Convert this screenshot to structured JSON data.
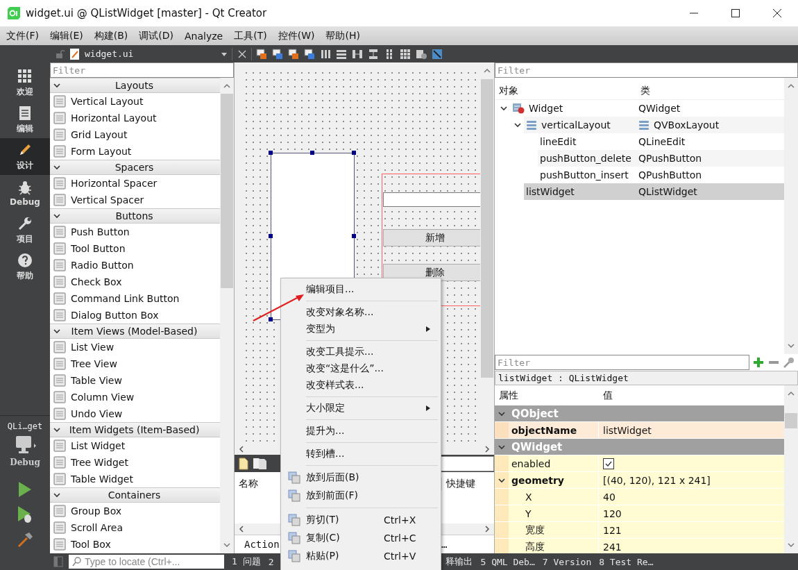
{
  "window": {
    "title": "widget.ui @ QListWidget [master] - Qt Creator"
  },
  "menu_bar": [
    "文件(F)",
    "编辑(E)",
    "构建(B)",
    "调试(D)",
    "Analyze",
    "工具(T)",
    "控件(W)",
    "帮助(H)"
  ],
  "mode_bar": {
    "modes": [
      {
        "label": "欢迎",
        "selected": false
      },
      {
        "label": "编辑",
        "selected": false
      },
      {
        "label": "设计",
        "selected": true
      },
      {
        "label": "Debug",
        "selected": false
      },
      {
        "label": "项目",
        "selected": false
      },
      {
        "label": "帮助",
        "selected": false
      }
    ],
    "kit": "QLi…get",
    "build_config": "Debug"
  },
  "editor_toolbar": {
    "file": "widget.ui"
  },
  "widget_box": {
    "filter": {
      "placeholder": "Filter"
    },
    "categories": [
      {
        "title": "Layouts",
        "expanded": true,
        "items": [
          "Vertical Layout",
          "Horizontal Layout",
          "Grid Layout",
          "Form Layout"
        ]
      },
      {
        "title": "Spacers",
        "expanded": true,
        "items": [
          "Horizontal Spacer",
          "Vertical Spacer"
        ]
      },
      {
        "title": "Buttons",
        "expanded": true,
        "items": [
          "Push Button",
          "Tool Button",
          "Radio Button",
          "Check Box",
          "Command Link Button",
          "Dialog Button Box"
        ]
      },
      {
        "title": "Item Views (Model-Based)",
        "expanded": true,
        "items": [
          "List View",
          "Tree View",
          "Table View",
          "Column View",
          "Undo View"
        ]
      },
      {
        "title": "Item Widgets (Item-Based)",
        "expanded": true,
        "items": [
          "List Widget",
          "Tree Widget",
          "Table Widget"
        ]
      },
      {
        "title": "Containers",
        "expanded": true,
        "items": [
          "Group Box",
          "Scroll Area",
          "Tool Box"
        ]
      }
    ]
  },
  "form": {
    "list_widget": {
      "selected": true
    },
    "buttons": [
      "新增",
      "删除"
    ]
  },
  "action_editor": {
    "columns": [
      "名称",
      "快捷键"
    ],
    "tab": "Action",
    "more": "…"
  },
  "object_inspector": {
    "filter": {
      "placeholder": "Filter"
    },
    "columns": [
      "对象",
      "类"
    ],
    "tree": [
      {
        "name": "Widget",
        "class": "QWidget",
        "kind": "form",
        "expanded": true,
        "selected": false,
        "children": [
          {
            "name": "verticalLayout",
            "class": "QVBoxLayout",
            "kind": "layout",
            "expanded": true,
            "selected": false,
            "children": [
              {
                "name": "lineEdit",
                "class": "QLineEdit",
                "selected": false
              },
              {
                "name": "pushButton_delete",
                "class": "QPushButton",
                "selected": false
              },
              {
                "name": "pushButton_insert",
                "class": "QPushButton",
                "selected": false
              }
            ]
          },
          {
            "name": "listWidget",
            "class": "QListWidget",
            "selected": true
          }
        ]
      }
    ]
  },
  "property_editor": {
    "filter": {
      "placeholder": "Filter"
    },
    "object_label": "listWidget : QListWidget",
    "columns": [
      "属性",
      "值"
    ],
    "groups": [
      {
        "name": "QObject",
        "expanded": true,
        "color": "#fdebd7",
        "properties": [
          {
            "name": "objectName",
            "kind": "text",
            "value": "listWidget",
            "modified": true
          }
        ]
      },
      {
        "name": "QWidget",
        "expanded": true,
        "color": "#fffbd2",
        "properties": [
          {
            "name": "enabled",
            "kind": "checkbox",
            "checked": true,
            "modified": false
          },
          {
            "name": "geometry",
            "kind": "text",
            "value": "[(40, 120), 121 x 241]",
            "modified": true,
            "expanded": true,
            "children": [
              {
                "name": "X",
                "kind": "text",
                "value": "40",
                "modified": false
              },
              {
                "name": "Y",
                "kind": "text",
                "value": "120",
                "modified": false
              },
              {
                "name": "宽度",
                "kind": "text",
                "value": "121",
                "modified": false
              },
              {
                "name": "高度",
                "kind": "text",
                "value": "241",
                "modified": false
              }
            ]
          }
        ]
      }
    ]
  },
  "context_menu": {
    "items": [
      {
        "kind": "action",
        "label": "编辑项目...",
        "submenu": false
      },
      {
        "kind": "separator"
      },
      {
        "kind": "action",
        "label": "改变对象名称...",
        "submenu": false
      },
      {
        "kind": "action",
        "label": "变型为",
        "submenu": true
      },
      {
        "kind": "separator"
      },
      {
        "kind": "action",
        "label": "改变工具提示...",
        "submenu": false
      },
      {
        "kind": "action",
        "label": "改变“这是什么”...",
        "submenu": false
      },
      {
        "kind": "action",
        "label": "改变样式表...",
        "submenu": false
      },
      {
        "kind": "separator"
      },
      {
        "kind": "action",
        "label": "大小限定",
        "submenu": true
      },
      {
        "kind": "separator"
      },
      {
        "kind": "action",
        "label": "提升为...",
        "submenu": false
      },
      {
        "kind": "separator"
      },
      {
        "kind": "action",
        "label": "转到槽...",
        "submenu": false
      },
      {
        "kind": "separator"
      },
      {
        "kind": "icon-action",
        "label": "放到后面(B)",
        "submenu": false
      },
      {
        "kind": "icon-action",
        "label": "放到前面(F)",
        "submenu": false
      },
      {
        "kind": "separator"
      },
      {
        "kind": "icon-action",
        "label": "剪切(T)",
        "shortcut": "Ctrl+X",
        "submenu": false
      },
      {
        "kind": "icon-action",
        "label": "复制(C)",
        "shortcut": "Ctrl+C",
        "submenu": false
      },
      {
        "kind": "icon-action",
        "label": "粘贴(P)",
        "shortcut": "Ctrl+V",
        "submenu": false
      }
    ]
  },
  "status_bar": {
    "locate": {
      "placeholder": "Type to locate (Ctrl+..."
    },
    "panes": [
      "1 问题",
      "2",
      "释输出",
      "5 QML Deb…",
      "7 Version",
      "8 Test Re…"
    ]
  }
}
